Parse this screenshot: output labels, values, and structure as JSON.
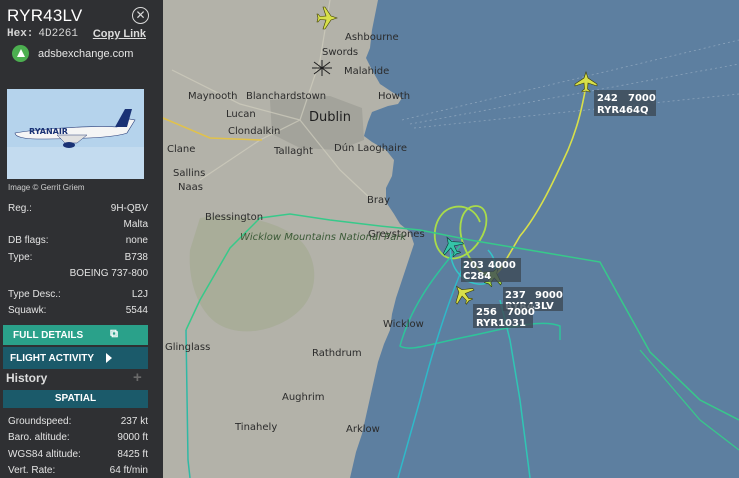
{
  "panel": {
    "callsign": "RYR43LV",
    "hex_label": "Hex:",
    "hex_value": "4D2261",
    "copy_link": "Copy Link",
    "site": "adsbexchange.com",
    "image_credit": "Image © Gerrit Griem",
    "photo_livery_text": "RYANAIR"
  },
  "info": [
    {
      "key": "Reg.:",
      "value": "9H-QBV"
    },
    {
      "key": "",
      "value": "Malta"
    },
    {
      "key": "DB flags:",
      "value": "none"
    },
    {
      "key": "Type:",
      "value": "B738"
    },
    {
      "key": "",
      "value": "BOEING 737-800"
    },
    {
      "key": "Type Desc.:",
      "value": "L2J"
    },
    {
      "key": "Squawk:",
      "value": "5544"
    }
  ],
  "buttons": {
    "full_details": "FULL DETAILS",
    "flight_activity": "FLIGHT ACTIVITY",
    "history": "History",
    "spatial": "SPATIAL"
  },
  "spatial": [
    {
      "key": "Groundspeed:",
      "value": "237 kt"
    },
    {
      "key": "Baro. altitude:",
      "value": "9000 ft"
    },
    {
      "key": "WGS84 altitude:",
      "value": "8425 ft"
    },
    {
      "key": "Vert. Rate:",
      "value": "64 ft/min"
    }
  ],
  "map": {
    "places": [
      "Ashbourne",
      "Swords",
      "Malahide",
      "Maynooth",
      "Blanchardstown",
      "Howth",
      "Dublin",
      "Lucan",
      "Clondalkin",
      "Clane",
      "Tallaght",
      "Dún Laoghaire",
      "Sallins",
      "Naas",
      "Bray",
      "Blessington",
      "Greystones",
      "Wicklow Mountains National Park",
      "Wicklow",
      "Rathdrum",
      "Aughrim",
      "Tinahely",
      "Arklow",
      "Glinglass"
    ],
    "aircraft": [
      {
        "speed": "242",
        "alt": "7000",
        "callsign": "RYR464Q"
      },
      {
        "speed": "203",
        "alt": "4000",
        "callsign": "C284"
      },
      {
        "speed": "237",
        "alt": "9000",
        "callsign": "RYR43LV"
      },
      {
        "speed": "256",
        "alt": "7000",
        "callsign": "RYR1031"
      }
    ],
    "colors": {
      "sea": "#5d7fa0",
      "land": "#b4b3aa",
      "track_green": "#3ecf8e",
      "track_yellow": "#d8e04a",
      "track_cyan": "#2fb9c9"
    }
  }
}
